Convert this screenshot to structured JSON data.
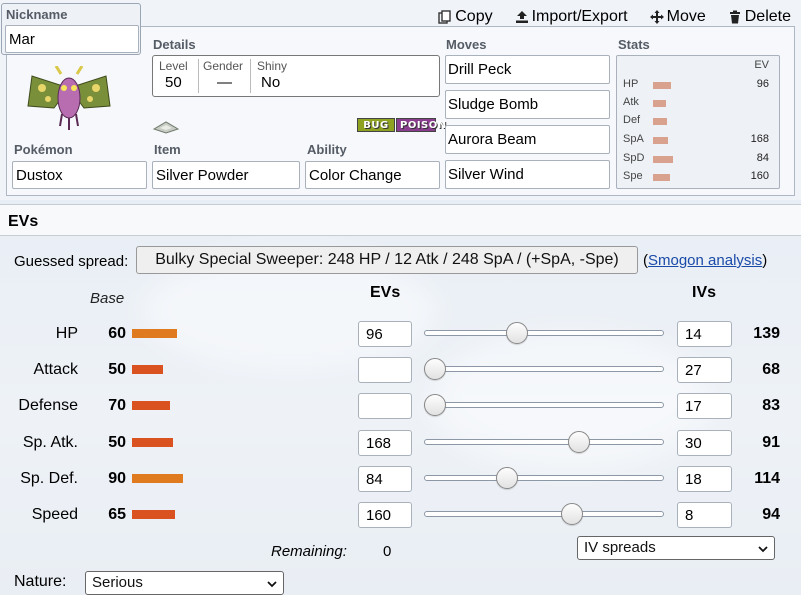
{
  "nickname": {
    "label": "Nickname",
    "value": "Mar"
  },
  "toolbar": {
    "copy": "Copy",
    "import_export": "Import/Export",
    "move": "Move",
    "delete": "Delete"
  },
  "details": {
    "label": "Details",
    "level_label": "Level",
    "level": "50",
    "gender_label": "Gender",
    "gender": "—",
    "shiny_label": "Shiny",
    "shiny": "No"
  },
  "types": [
    "BUG",
    "POISON"
  ],
  "pokemon": {
    "label": "Pokémon",
    "value": "Dustox"
  },
  "item": {
    "label": "Item",
    "value": "Silver Powder"
  },
  "ability": {
    "label": "Ability",
    "value": "Color Change"
  },
  "moves": {
    "label": "Moves",
    "list": [
      "Drill Peck",
      "Sludge Bomb",
      "Aurora Beam",
      "Silver Wind"
    ]
  },
  "stats": {
    "label": "Stats",
    "ev_header": "EV",
    "rows": [
      {
        "name": "HP",
        "ev": "96"
      },
      {
        "name": "Atk",
        "ev": ""
      },
      {
        "name": "Def",
        "ev": ""
      },
      {
        "name": "SpA",
        "ev": "168"
      },
      {
        "name": "SpD",
        "ev": "84"
      },
      {
        "name": "Spe",
        "ev": "160"
      }
    ]
  },
  "evs_section": {
    "title": "EVs",
    "guessed_label": "Guessed spread:",
    "guessed_spread": "Bulky Special Sweeper: 248 HP / 12 Atk / 248 SpA / (+SpA, -Spe)",
    "smogon_open": "(",
    "smogon_link": "Smogon analysis",
    "smogon_close": ")",
    "base_header": "Base",
    "evs_header": "EVs",
    "ivs_header": "IVs",
    "rows": [
      {
        "name": "HP",
        "base": "60",
        "ev": "96",
        "iv": "14",
        "total": "139",
        "ev_fraction": 0.3765
      },
      {
        "name": "Attack",
        "base": "50",
        "ev": "",
        "iv": "27",
        "total": "68",
        "ev_fraction": 0
      },
      {
        "name": "Defense",
        "base": "70",
        "ev": "",
        "iv": "17",
        "total": "83",
        "ev_fraction": 0
      },
      {
        "name": "Sp. Atk.",
        "base": "50",
        "ev": "168",
        "iv": "30",
        "total": "91",
        "ev_fraction": 0.6588
      },
      {
        "name": "Sp. Def.",
        "base": "90",
        "ev": "84",
        "iv": "18",
        "total": "114",
        "ev_fraction": 0.3294
      },
      {
        "name": "Speed",
        "base": "65",
        "ev": "160",
        "iv": "8",
        "total": "94",
        "ev_fraction": 0.6275
      }
    ],
    "remaining_label": "Remaining:",
    "remaining": "0",
    "iv_spreads": "IV spreads",
    "nature_label": "Nature:",
    "nature": "Serious"
  },
  "colors": {
    "base_bar_orange": "#e07a1f",
    "base_bar_red": "#d9521f",
    "bug": "#8fa121",
    "poison": "#8a3d8e",
    "link": "#1a4aa8"
  }
}
